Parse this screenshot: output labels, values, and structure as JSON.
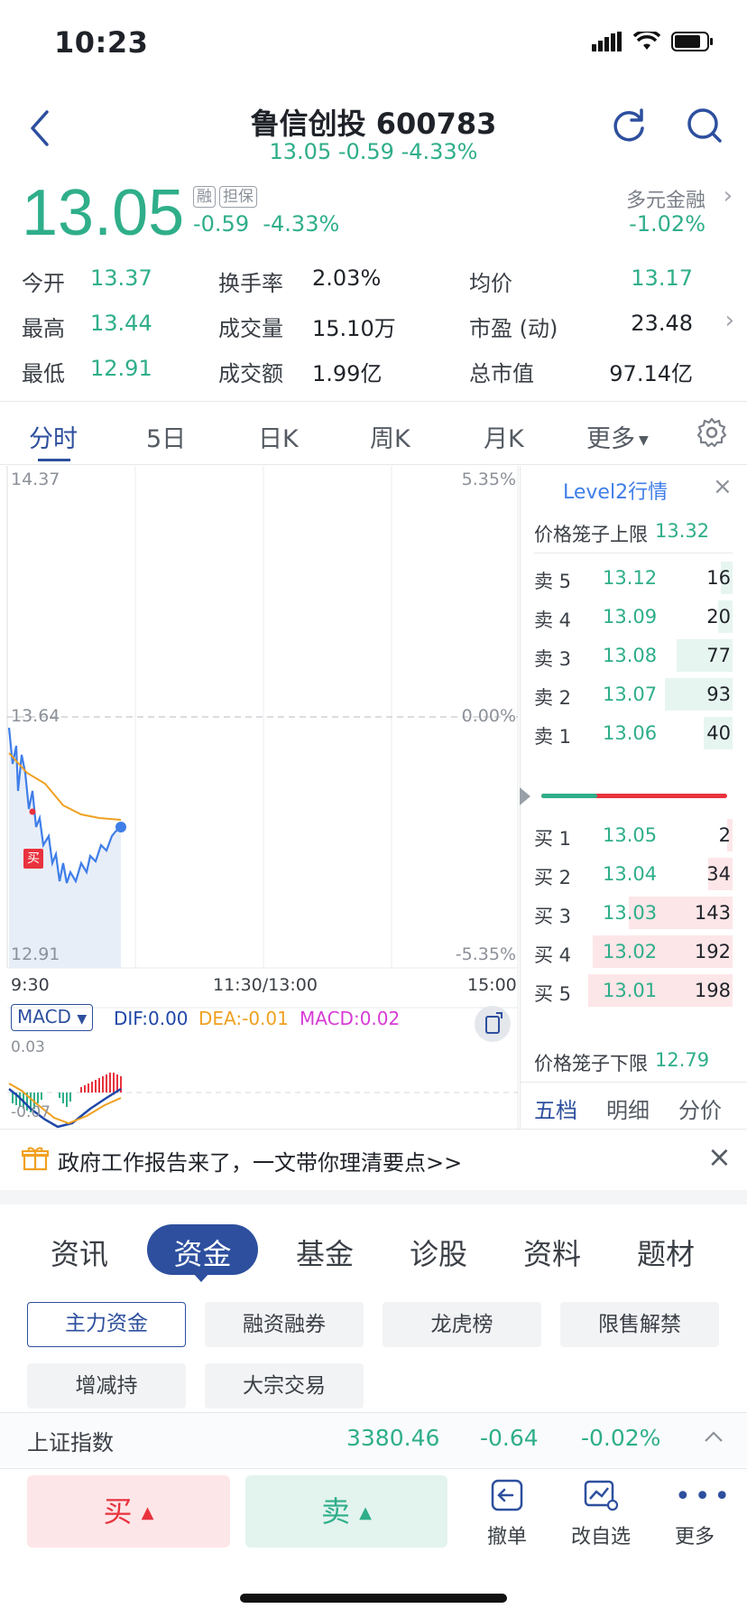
{
  "status": {
    "time": "10:23"
  },
  "header": {
    "title": "鲁信创投 600783",
    "subtitle": "13.05 -0.59 -4.33%"
  },
  "quote": {
    "price": "13.05",
    "tag1": "融",
    "tag2": "担保",
    "change": "-0.59",
    "change_pct": "-4.33%",
    "sector": "多元金融",
    "sector_change": "-1.02%"
  },
  "stats": [
    {
      "label": "今开",
      "value": "13.37"
    },
    {
      "label": "换手率",
      "value": "2.03%"
    },
    {
      "label": "均价",
      "value": "13.17"
    },
    {
      "label": "最高",
      "value": "13.44"
    },
    {
      "label": "成交量",
      "value": "15.10万"
    },
    {
      "label": "市盈 (动)",
      "value": "23.48"
    },
    {
      "label": "最低",
      "value": "12.91"
    },
    {
      "label": "成交额",
      "value": "1.99亿"
    },
    {
      "label": "总市值",
      "value": "97.14亿"
    }
  ],
  "chart_tabs": [
    "分时",
    "5日",
    "日K",
    "周K",
    "月K",
    "更多"
  ],
  "chart": {
    "y_top": "14.37",
    "y_mid": "13.64",
    "y_bot": "12.91",
    "pct_top": "5.35%",
    "pct_mid": "0.00%",
    "pct_bot": "-5.35%",
    "x_start": "9:30",
    "x_mid": "11:30/13:00",
    "x_end": "15:00",
    "buy_marker": "买",
    "macd_select": "MACD",
    "dif": "DIF:0.00",
    "dea": "DEA:-0.01",
    "macd": "MACD:0.02",
    "macd_top": "0.03",
    "macd_bot": "-0.07"
  },
  "orderbook": {
    "title": "Level2行情",
    "upper_limit_label": "价格笼子上限",
    "upper_limit": "13.32",
    "lower_limit_label": "价格笼子下限",
    "lower_limit": "12.79",
    "asks": [
      {
        "label": "卖 5",
        "price": "13.12",
        "vol": "16",
        "bar": 0.08
      },
      {
        "label": "卖 4",
        "price": "13.09",
        "vol": "20",
        "bar": 0.1
      },
      {
        "label": "卖 3",
        "price": "13.08",
        "vol": "77",
        "bar": 0.39
      },
      {
        "label": "卖 2",
        "price": "13.07",
        "vol": "93",
        "bar": 0.47
      },
      {
        "label": "卖 1",
        "price": "13.06",
        "vol": "40",
        "bar": 0.2
      }
    ],
    "bids": [
      {
        "label": "买 1",
        "price": "13.05",
        "vol": "2",
        "bar": 0.01
      },
      {
        "label": "买 2",
        "price": "13.04",
        "vol": "34",
        "bar": 0.17
      },
      {
        "label": "买 3",
        "price": "13.03",
        "vol": "143",
        "bar": 0.72
      },
      {
        "label": "买 4",
        "price": "13.02",
        "vol": "192",
        "bar": 0.97
      },
      {
        "label": "买 5",
        "price": "13.01",
        "vol": "198",
        "bar": 1.0
      }
    ],
    "tabs": [
      "五档",
      "明细",
      "分价"
    ]
  },
  "banner": {
    "text": "政府工作报告来了，一文带你理清要点>>"
  },
  "section_tabs": [
    "资讯",
    "资金",
    "基金",
    "诊股",
    "资料",
    "题材"
  ],
  "chips": [
    "主力资金",
    "融资融券",
    "龙虎榜",
    "限售解禁",
    "增减持",
    "大宗交易"
  ],
  "index": {
    "name": "上证指数",
    "value": "3380.46",
    "change": "-0.64",
    "change_pct": "-0.02%"
  },
  "trade": {
    "buy": "买",
    "sell": "卖",
    "cancel": "撤单",
    "watch": "改自选",
    "more": "更多"
  },
  "colors": {
    "up": "#e8333e",
    "down": "#2fae8a",
    "accent": "#2d4f9e",
    "avg_line": "#f0a020"
  }
}
